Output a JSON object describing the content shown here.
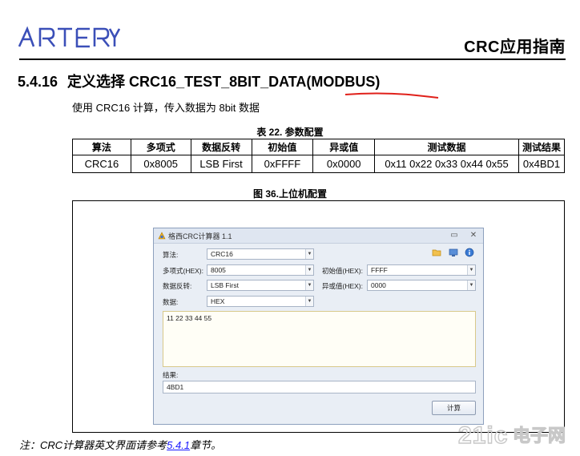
{
  "header": {
    "logo_text": "ARTERY",
    "doc_title": "CRC应用指南"
  },
  "section": {
    "number": "5.4.16",
    "title": "定义选择 CRC16_TEST_8BIT_DATA(MODBUS)"
  },
  "description": "使用 CRC16 计算，传入数据为 8bit 数据",
  "table": {
    "caption": "表 22. 参数配置",
    "headers": [
      "算法",
      "多项式",
      "数据反转",
      "初始值",
      "异或值",
      "测试数据",
      "测试结果"
    ],
    "rows": [
      [
        "CRC16",
        "0x8005",
        "LSB First",
        "0xFFFF",
        "0x0000",
        "0x11 0x22 0x33 0x44 0x55",
        "0x4BD1"
      ]
    ]
  },
  "figure": {
    "caption": "图 36.上位机配置"
  },
  "app": {
    "title": "格西CRC计算器 1.1",
    "algorithm_label": "算法:",
    "algorithm_value": "CRC16",
    "poly_label": "多项式(HEX):",
    "poly_value": "8005",
    "init_label": "初始值(HEX):",
    "init_value": "FFFF",
    "reverse_label": "数据反转:",
    "reverse_value": "LSB First",
    "xor_label": "异或值(HEX):",
    "xor_value": "0000",
    "data_label": "数据:",
    "data_format": "HEX",
    "data_text": "11 22 33 44 55",
    "result_label": "结果:",
    "result_value": "4BD1",
    "calc_button": "计算",
    "icons": [
      "folder-icon",
      "monitor-icon",
      "info-icon"
    ]
  },
  "footnote": {
    "prefix": "注：CRC计算器英文界面请参考",
    "link": "5.4.1",
    "suffix": "章节。"
  },
  "watermark": {
    "text": "21ic电子网"
  },
  "colors": {
    "logo_blue": "#3b4fb8",
    "red_underline": "#e0201a",
    "link": "#1a1aff"
  }
}
